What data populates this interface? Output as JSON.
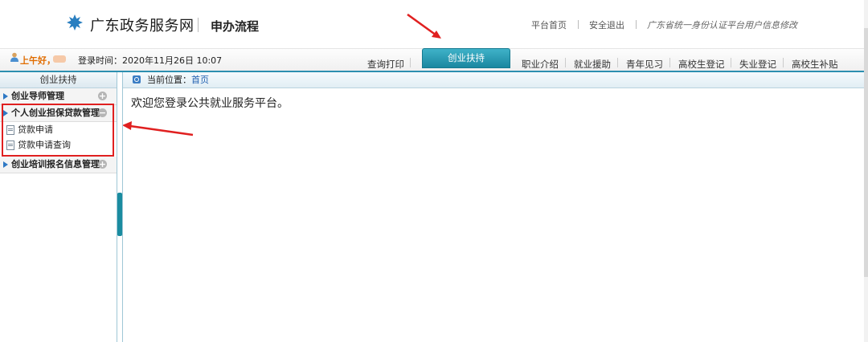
{
  "header": {
    "brand": "广东政务服务网",
    "subtitle": "申办流程",
    "links": [
      "平台首页",
      "安全退出"
    ],
    "notice": "广东省统一身份认证平台用户信息修改"
  },
  "user": {
    "greeting": "上午好，",
    "login_time": "登录时间：2020年11月26日 10:07"
  },
  "nav": {
    "left_items": [
      "查询打印"
    ],
    "active": "创业扶持",
    "right_items": [
      "职业介绍",
      "就业援助",
      "青年见习",
      "高校生登记",
      "失业登记",
      "高校生补贴"
    ]
  },
  "sidebar": {
    "title": "创业扶持",
    "groups": [
      {
        "label": "创业导师管理",
        "toggle": "+"
      },
      {
        "label": "个人创业担保贷款管理",
        "toggle": "−",
        "items": [
          "贷款申请",
          "贷款申请查询"
        ]
      },
      {
        "label": "创业培训报名信息管理",
        "toggle": "+"
      }
    ]
  },
  "main": {
    "location_label": "当前位置：",
    "location_link": "首页",
    "welcome": "欢迎您登录公共就业服务平台。"
  },
  "colors": {
    "accent": "#1a87a0",
    "annotation": "#e02020",
    "greeting": "#e06c00"
  }
}
